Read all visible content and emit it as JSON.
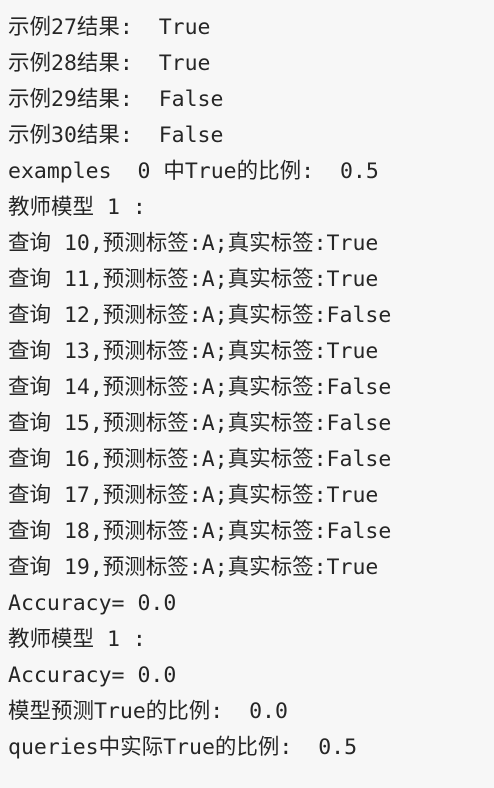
{
  "console": {
    "lines": [
      "示例27结果:  True",
      "示例28结果:  True",
      "示例29结果:  False",
      "示例30结果:  False",
      "examples  0 中True的比例:  0.5",
      "教师模型 1 :",
      "查询 10,预测标签:A;真实标签:True",
      "查询 11,预测标签:A;真实标签:True",
      "查询 12,预测标签:A;真实标签:False",
      "查询 13,预测标签:A;真实标签:True",
      "查询 14,预测标签:A;真实标签:False",
      "查询 15,预测标签:A;真实标签:False",
      "查询 16,预测标签:A;真实标签:False",
      "查询 17,预测标签:A;真实标签:True",
      "查询 18,预测标签:A;真实标签:False",
      "查询 19,预测标签:A;真实标签:True",
      "Accuracy= 0.0",
      "教师模型 1 :",
      "Accuracy= 0.0",
      "模型预测True的比例:  0.0",
      "queries中实际True的比例:  0.5"
    ]
  }
}
